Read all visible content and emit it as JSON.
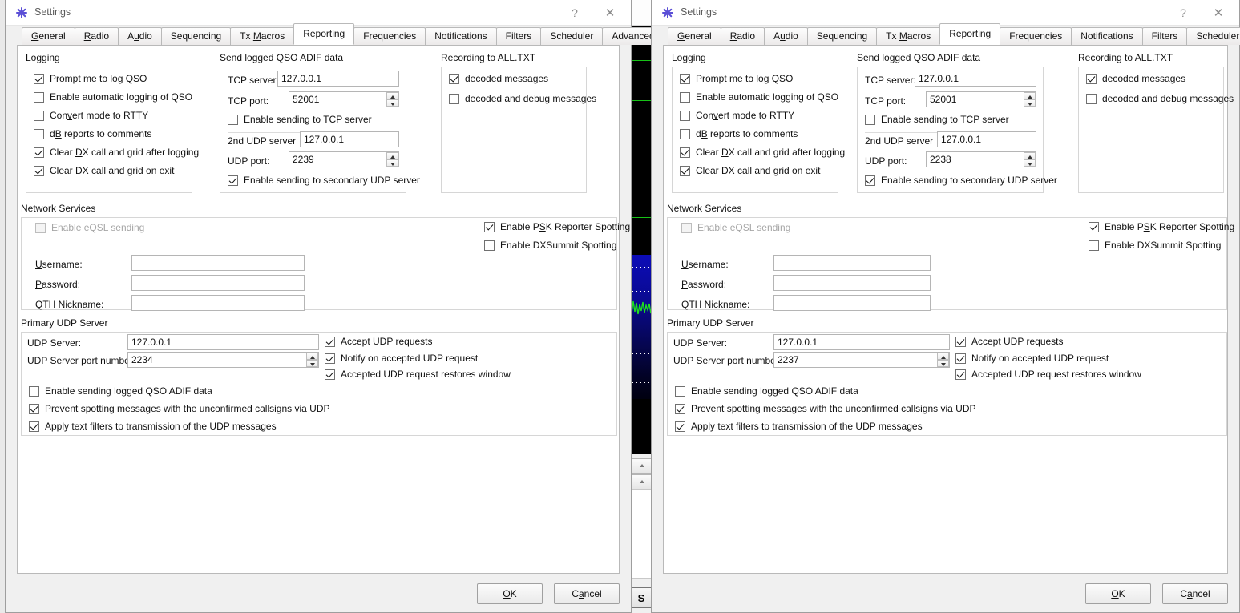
{
  "background_app": {
    "name": "wsjtx-waterfall",
    "side_button_label": "S"
  },
  "windows": [
    {
      "id": "left",
      "title": "Settings",
      "icon": "wsjtx-star-icon",
      "titlebar_buttons": [
        {
          "name": "help-button",
          "label": "?"
        },
        {
          "name": "close-button",
          "label": "✕"
        }
      ],
      "tabs": [
        {
          "label": "General",
          "mnemonic": "G",
          "active": false
        },
        {
          "label": "Radio",
          "mnemonic": "R",
          "active": false
        },
        {
          "label": "Audio",
          "mnemonic": "u",
          "active": false
        },
        {
          "label": "Sequencing",
          "mnemonic": "",
          "active": false
        },
        {
          "label": "Tx Macros",
          "mnemonic": "M",
          "active": false
        },
        {
          "label": "Reporting",
          "mnemonic": "",
          "active": true
        },
        {
          "label": "Frequencies",
          "mnemonic": "",
          "active": false
        },
        {
          "label": "Notifications",
          "mnemonic": "",
          "active": false
        },
        {
          "label": "Filters",
          "mnemonic": "",
          "active": false
        },
        {
          "label": "Scheduler",
          "mnemonic": "",
          "active": false
        },
        {
          "label": "Advanced",
          "mnemonic": "",
          "active": false
        }
      ],
      "tab_arrows": false,
      "logging": {
        "group_title": "Logging",
        "items": [
          {
            "label": "Prompt me to log QSO",
            "checked": true
          },
          {
            "label": "Enable automatic logging of QSO",
            "checked": false
          },
          {
            "label": "Convert mode to RTTY",
            "checked": false
          },
          {
            "label": "dB reports to comments",
            "checked": false
          },
          {
            "label": "Clear DX call and grid after logging",
            "checked": true
          },
          {
            "label": "Clear DX call and grid on exit",
            "checked": true
          }
        ]
      },
      "adif": {
        "group_title": "Send logged QSO ADIF data",
        "tcp_server_label": "TCP server:",
        "tcp_server_value": "127.0.0.1",
        "tcp_port_label": "TCP port:",
        "tcp_port_value": "52001",
        "enable_tcp_label": "Enable sending to TCP server",
        "enable_tcp_checked": false,
        "udp2_server_label": "2nd UDP server",
        "udp2_server_value": "127.0.0.1",
        "udp_port_label": "UDP port:",
        "udp_port_value": "2239",
        "enable_udp2_label": "Enable sending to secondary UDP server",
        "enable_udp2_checked": true
      },
      "recording": {
        "group_title": "Recording to ALL.TXT",
        "items": [
          {
            "label": "decoded messages",
            "checked": true
          },
          {
            "label": "decoded and debug messages",
            "checked": false
          }
        ]
      },
      "network": {
        "group_title": "Network Services",
        "eqsl_label": "Enable eQSL sending",
        "eqsl_checked": false,
        "eqsl_disabled": true,
        "psk_label": "Enable PSK Reporter Spotting",
        "psk_checked": true,
        "dxsummit_label": "Enable DXSummit Spotting",
        "dxsummit_checked": false,
        "username_label": "Username:",
        "username_value": "",
        "password_label": "Password:",
        "password_value": "",
        "qth_label": "QTH Nickname:",
        "qth_value": ""
      },
      "primary_udp": {
        "group_title": "Primary UDP Server",
        "server_label": "UDP Server:",
        "server_value": "127.0.0.1",
        "port_label": "UDP Server port number:",
        "port_value": "2234",
        "accept_label": "Accept UDP requests",
        "accept_checked": true,
        "notify_label": "Notify on accepted UDP request",
        "notify_checked": true,
        "restore_label": "Accepted UDP request restores window",
        "restore_checked": true,
        "adif_label": "Enable sending logged QSO ADIF data",
        "adif_checked": false,
        "prevent_label": "Prevent spotting messages with the unconfirmed callsigns via UDP",
        "prevent_checked": true,
        "filters_label": "Apply text filters to transmission of the UDP messages",
        "filters_checked": true
      },
      "buttons": {
        "ok": "OK",
        "cancel": "Cancel"
      }
    },
    {
      "id": "right",
      "title": "Settings",
      "icon": "wsjtx-star-icon",
      "titlebar_buttons": [
        {
          "name": "help-button",
          "label": "?"
        },
        {
          "name": "close-button",
          "label": "✕"
        }
      ],
      "tabs": [
        {
          "label": "General",
          "mnemonic": "G",
          "active": false
        },
        {
          "label": "Radio",
          "mnemonic": "R",
          "active": false
        },
        {
          "label": "Audio",
          "mnemonic": "u",
          "active": false
        },
        {
          "label": "Sequencing",
          "mnemonic": "",
          "active": false
        },
        {
          "label": "Tx Macros",
          "mnemonic": "M",
          "active": false
        },
        {
          "label": "Reporting",
          "mnemonic": "",
          "active": true
        },
        {
          "label": "Frequencies",
          "mnemonic": "",
          "active": false
        },
        {
          "label": "Notifications",
          "mnemonic": "",
          "active": false
        },
        {
          "label": "Filters",
          "mnemonic": "",
          "active": false
        },
        {
          "label": "Scheduler",
          "mnemonic": "",
          "active": false
        }
      ],
      "tab_arrows": true,
      "tab_arrow_left": "◀",
      "tab_arrow_right": "▶",
      "logging": {
        "group_title": "Logging",
        "items": [
          {
            "label": "Prompt me to log QSO",
            "checked": true
          },
          {
            "label": "Enable automatic logging of QSO",
            "checked": false
          },
          {
            "label": "Convert mode to RTTY",
            "checked": false
          },
          {
            "label": "dB reports to comments",
            "checked": false
          },
          {
            "label": "Clear DX call and grid after logging",
            "checked": true
          },
          {
            "label": "Clear DX call and grid on exit",
            "checked": true
          }
        ]
      },
      "adif": {
        "group_title": "Send logged QSO ADIF data",
        "tcp_server_label": "TCP server:",
        "tcp_server_value": "127.0.0.1",
        "tcp_port_label": "TCP port:",
        "tcp_port_value": "52001",
        "enable_tcp_label": "Enable sending to TCP server",
        "enable_tcp_checked": false,
        "udp2_server_label": "2nd UDP server",
        "udp2_server_value": "127.0.0.1",
        "udp_port_label": "UDP port:",
        "udp_port_value": "2238",
        "enable_udp2_label": "Enable sending to secondary UDP server",
        "enable_udp2_checked": true
      },
      "recording": {
        "group_title": "Recording to ALL.TXT",
        "items": [
          {
            "label": "decoded messages",
            "checked": true
          },
          {
            "label": "decoded and debug messages",
            "checked": false
          }
        ]
      },
      "network": {
        "group_title": "Network Services",
        "eqsl_label": "Enable eQSL sending",
        "eqsl_checked": false,
        "eqsl_disabled": true,
        "psk_label": "Enable PSK Reporter Spotting",
        "psk_checked": true,
        "dxsummit_label": "Enable DXSummit Spotting",
        "dxsummit_checked": false,
        "username_label": "Username:",
        "username_value": "",
        "password_label": "Password:",
        "password_value": "",
        "qth_label": "QTH Nickname:",
        "qth_value": ""
      },
      "primary_udp": {
        "group_title": "Primary UDP Server",
        "server_label": "UDP Server:",
        "server_value": "127.0.0.1",
        "port_label": "UDP Server port number:",
        "port_value": "2237",
        "accept_label": "Accept UDP requests",
        "accept_checked": true,
        "notify_label": "Notify on accepted UDP request",
        "notify_checked": true,
        "restore_label": "Accepted UDP request restores window",
        "restore_checked": true,
        "adif_label": "Enable sending logged QSO ADIF data",
        "adif_checked": false,
        "prevent_label": "Prevent spotting messages with the unconfirmed callsigns via UDP",
        "prevent_checked": true,
        "filters_label": "Apply text filters to transmission of the UDP messages",
        "filters_checked": true
      },
      "buttons": {
        "ok": "OK",
        "cancel": "Cancel"
      }
    }
  ],
  "colors": {
    "dialog_bg": "#f0f0f0",
    "page_bg": "#ffffff",
    "accent_icon": "#5b4fd6",
    "waterfall_green": "#17c117",
    "waterfall_blue": "#0c0cb8"
  }
}
